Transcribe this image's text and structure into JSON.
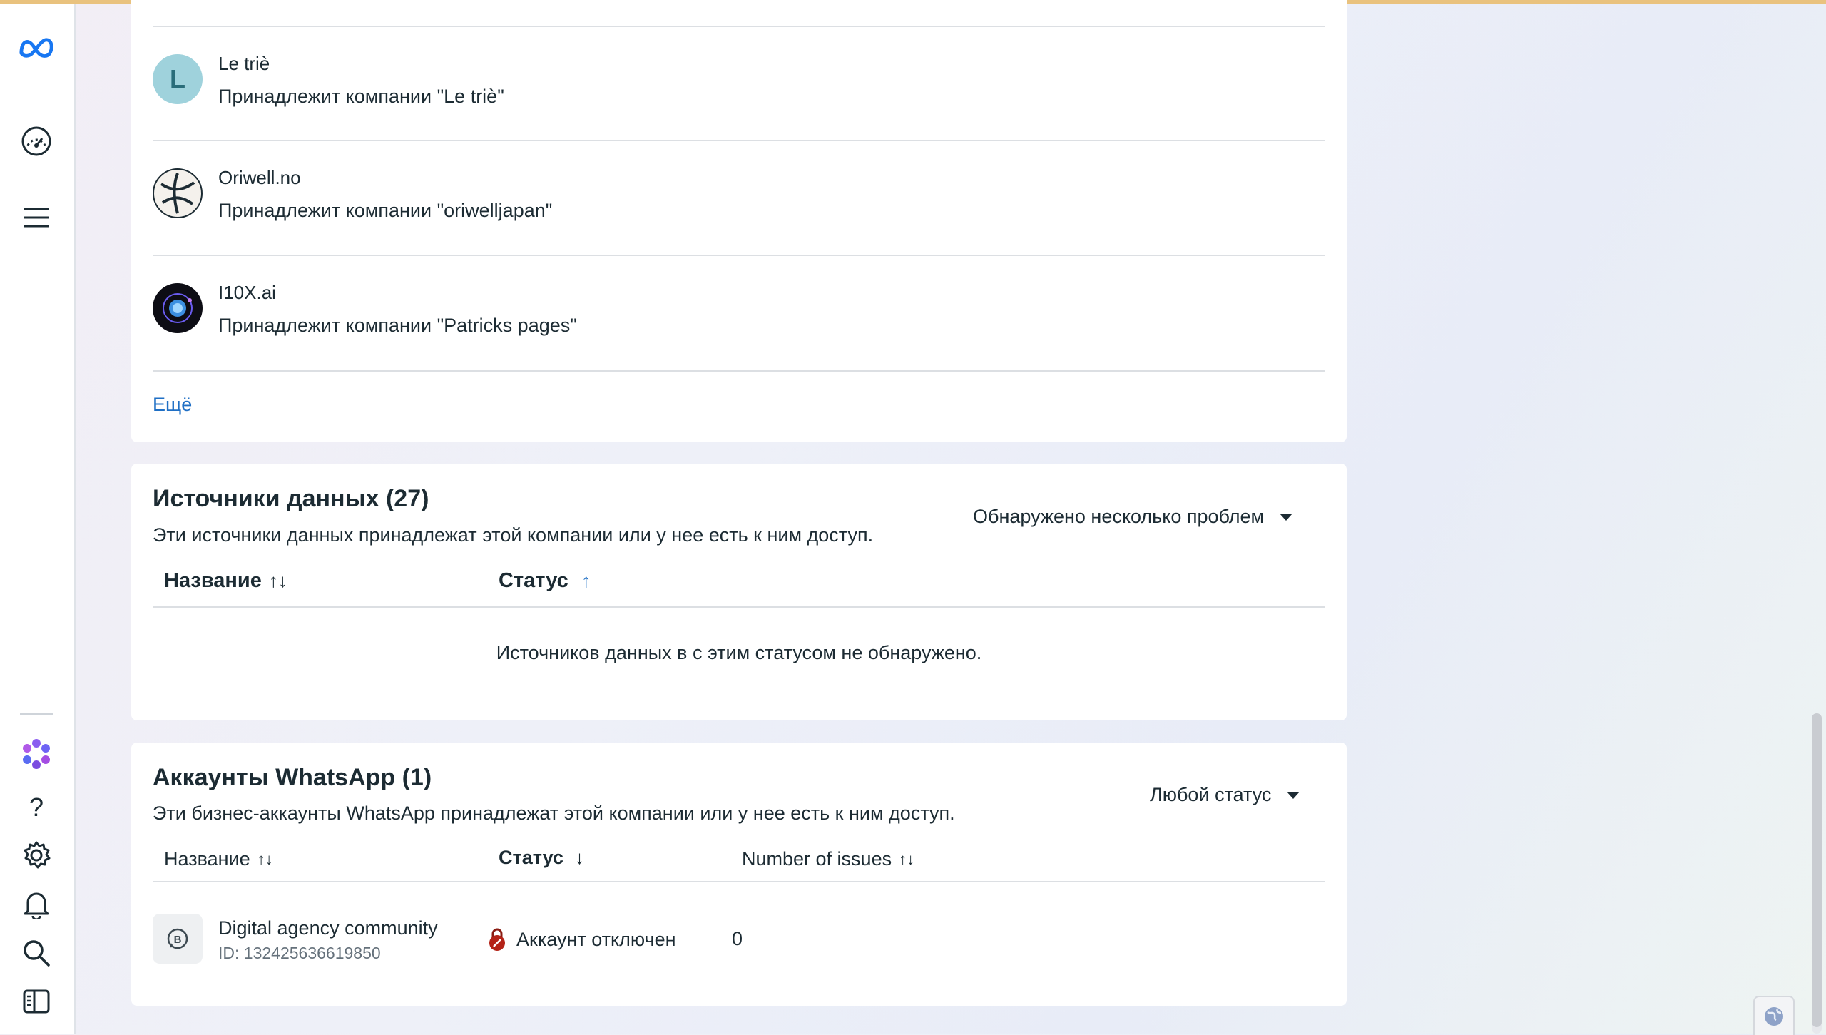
{
  "sidebar": {
    "icons": [
      "meta-logo-icon",
      "dashboard-gauge-icon",
      "menu-hamburger-icon",
      "meta-ai-flower-icon",
      "help-question-icon",
      "settings-gear-icon",
      "notifications-bell-icon",
      "search-icon",
      "panel-toggle-icon"
    ],
    "help_glyph": "?"
  },
  "pages": {
    "items": [
      {
        "initial": "L",
        "name": "Le triè",
        "owner": "Принадлежит компании \"Le triè\"",
        "avatar_color": "#9fd2dc"
      },
      {
        "name": "Oriwell.no",
        "owner": "Принадлежит компании \"oriwelljapan\""
      },
      {
        "name": "I10X.ai",
        "owner": "Принадлежит компании \"Patricks pages\""
      }
    ],
    "more_label": "Ещё"
  },
  "data_sources": {
    "title": "Источники данных (27)",
    "description": "Эти источники данных принадлежат этой компании или у нее есть к ним доступ.",
    "filter_label": "Обнаружено несколько проблем",
    "columns": {
      "name": "Название",
      "status": "Статус"
    },
    "sort_name": "↑↓",
    "sort_status": "↑",
    "empty_message": "Источников данных в с этим статусом не обнаружено."
  },
  "whatsapp": {
    "title": "Аккаунты WhatsApp (1)",
    "description": "Эти бизнес-аккаунты WhatsApp принадлежат этой компании или у нее есть к ним доступ.",
    "filter_label": "Любой статус",
    "columns": {
      "name": "Название",
      "status": "Статус",
      "issues": "Number of issues"
    },
    "sort_name": "↑↓",
    "sort_status": "↓",
    "sort_issues": "↑↓",
    "rows": [
      {
        "name": "Digital agency community",
        "id": "ID: 132425636619850",
        "status": "Аккаунт отключен",
        "issues": "0",
        "status_color": "#b42318"
      }
    ]
  },
  "colors": {
    "accent": "#1f6fc5",
    "top_bar": "#e9c27e"
  }
}
